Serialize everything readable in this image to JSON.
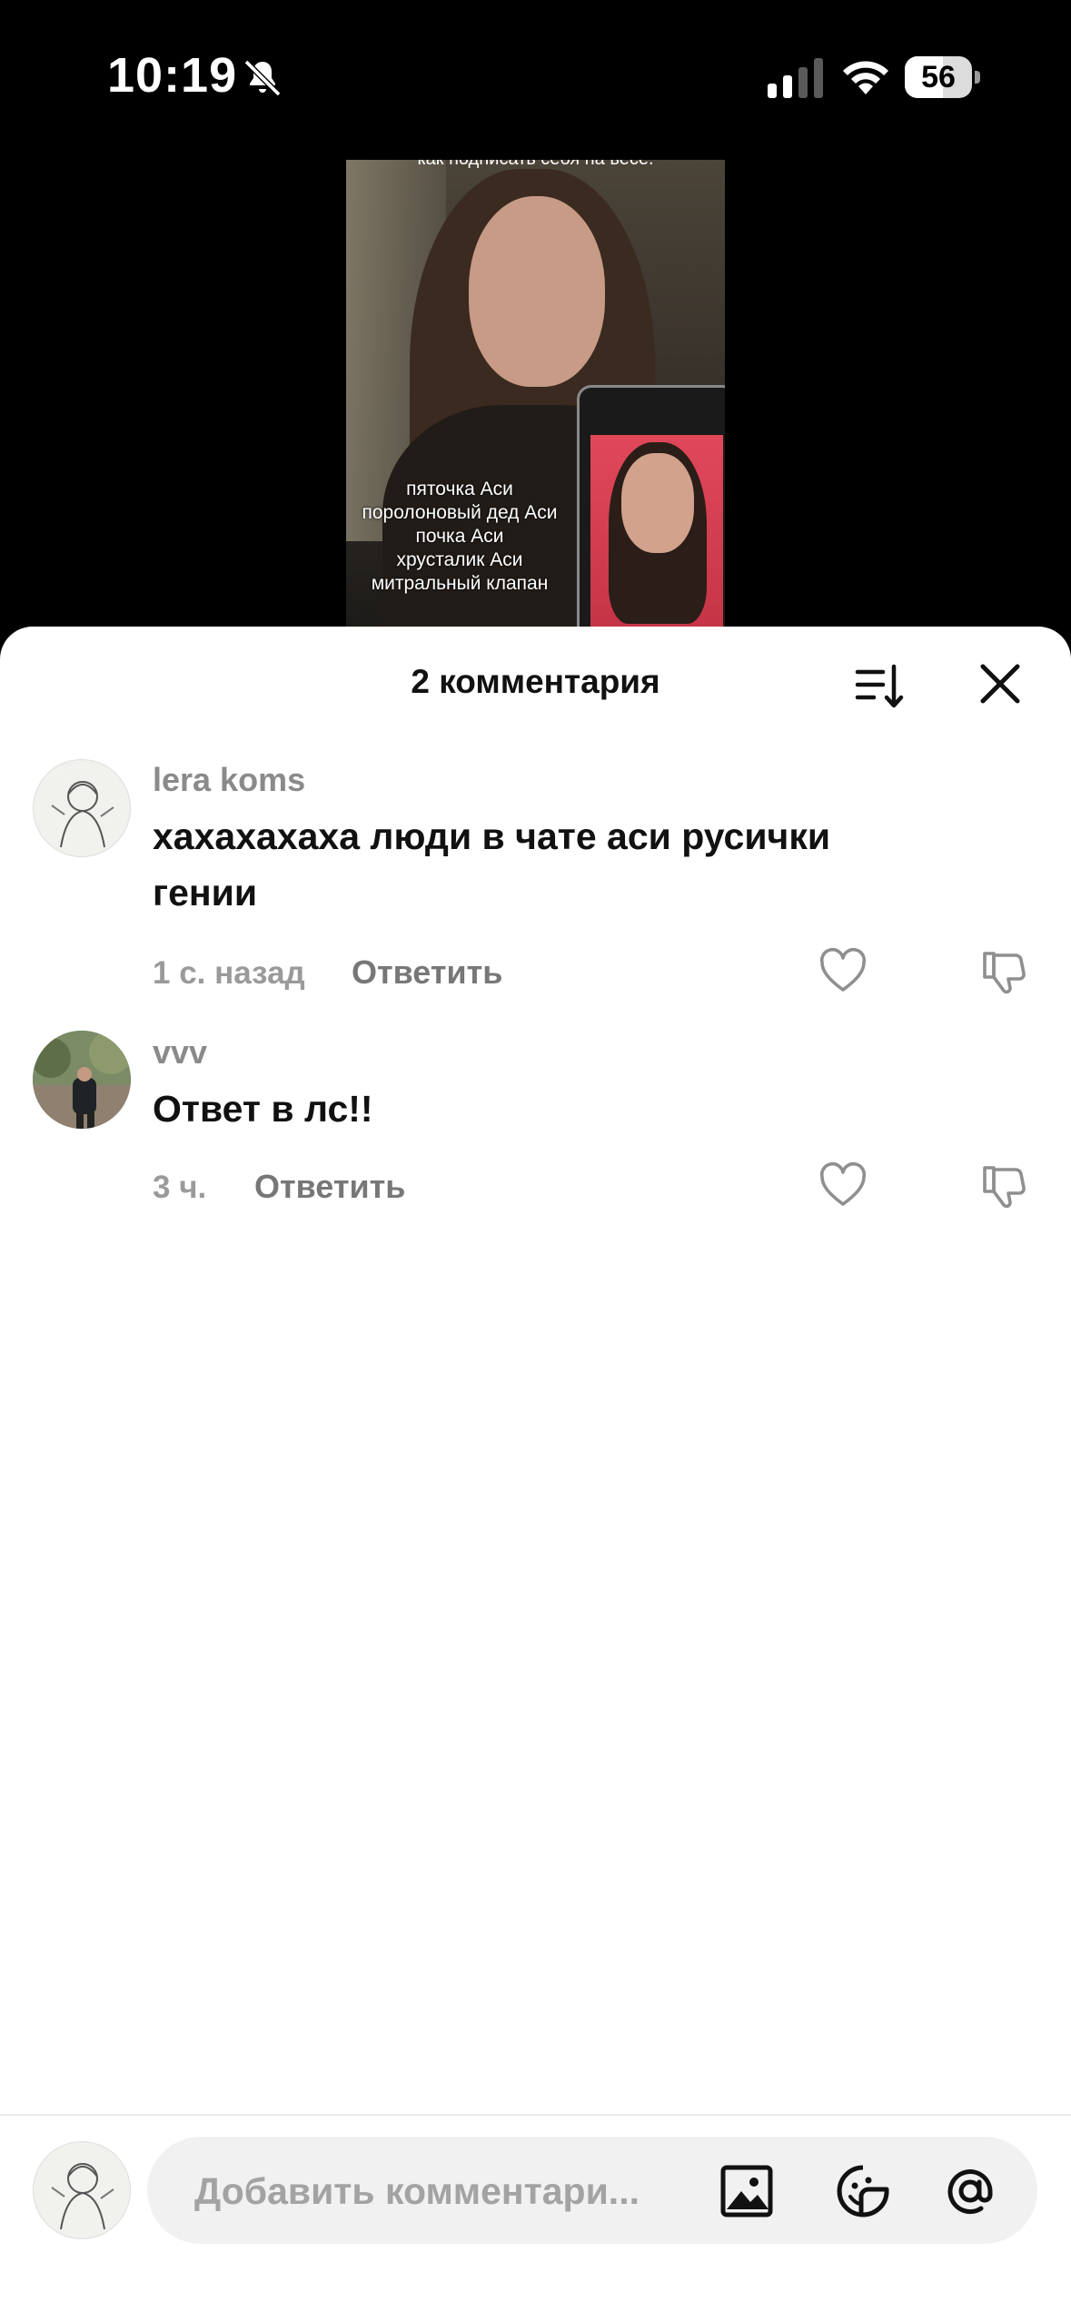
{
  "status_bar": {
    "time": "10:19",
    "battery": "56"
  },
  "video": {
    "caption_top": "как поднисать себя на весе.",
    "caption_lines": [
      "пяточка Аси",
      "поролоновый дед Аси",
      "почка Аси",
      "хрусталик Аси",
      "митральный клапан"
    ]
  },
  "sheet": {
    "title": "2 комментария"
  },
  "comments": [
    {
      "author": "lera koms",
      "text": "хахахахаха люди в чате аси русички гении",
      "time": "1 с. назад",
      "reply": "Ответить"
    },
    {
      "author": "vvv",
      "text": "Ответ в лс!!",
      "time": "3 ч.",
      "reply": "Ответить"
    }
  ],
  "composer": {
    "placeholder": "Добавить комментари..."
  },
  "icons": [
    "bell-slash-icon",
    "signal-icon",
    "wifi-icon",
    "battery-icon",
    "sort-icon",
    "close-icon",
    "heart-icon",
    "dislike-icon",
    "image-icon",
    "sticker-icon",
    "mention-icon"
  ]
}
